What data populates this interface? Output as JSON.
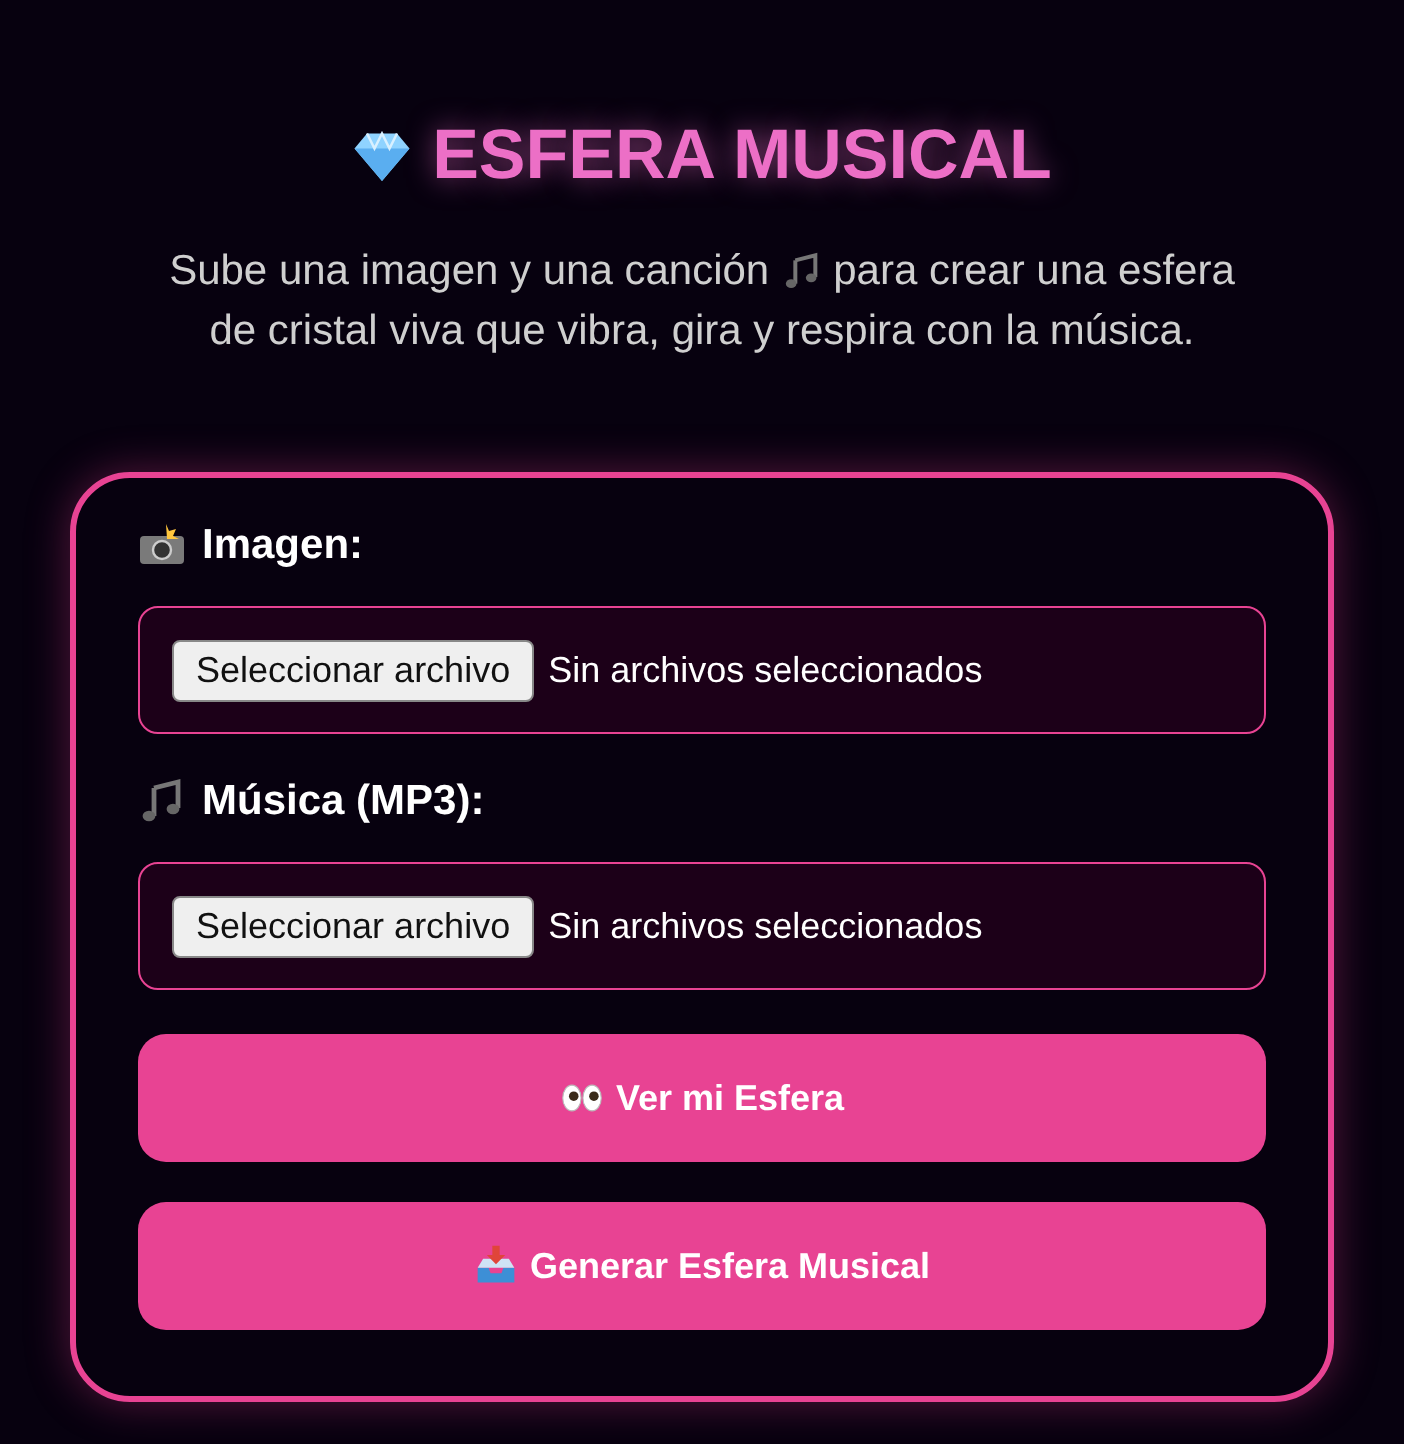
{
  "title": {
    "text": "ESFERA MUSICAL"
  },
  "description_lines": [
    {
      "kind": "with_note",
      "before": "Sube una imagen y una canción",
      "after": "para crear una esfera"
    },
    {
      "kind": "plain",
      "before": "de cristal viva que vibra, gira y respira con la música."
    }
  ],
  "fields": [
    {
      "kind": "image",
      "label": "Imagen:",
      "button": "Seleccionar archivo",
      "status": "Sin archivos seleccionados"
    },
    {
      "kind": "audio",
      "label": "Música (MP3):",
      "button": "Seleccionar archivo",
      "status": "Sin archivos seleccionados"
    }
  ],
  "buttons": [
    {
      "kind": "view",
      "label": "Ver mi Esfera"
    },
    {
      "kind": "generate",
      "label": "Generar Esfera Musical"
    }
  ]
}
